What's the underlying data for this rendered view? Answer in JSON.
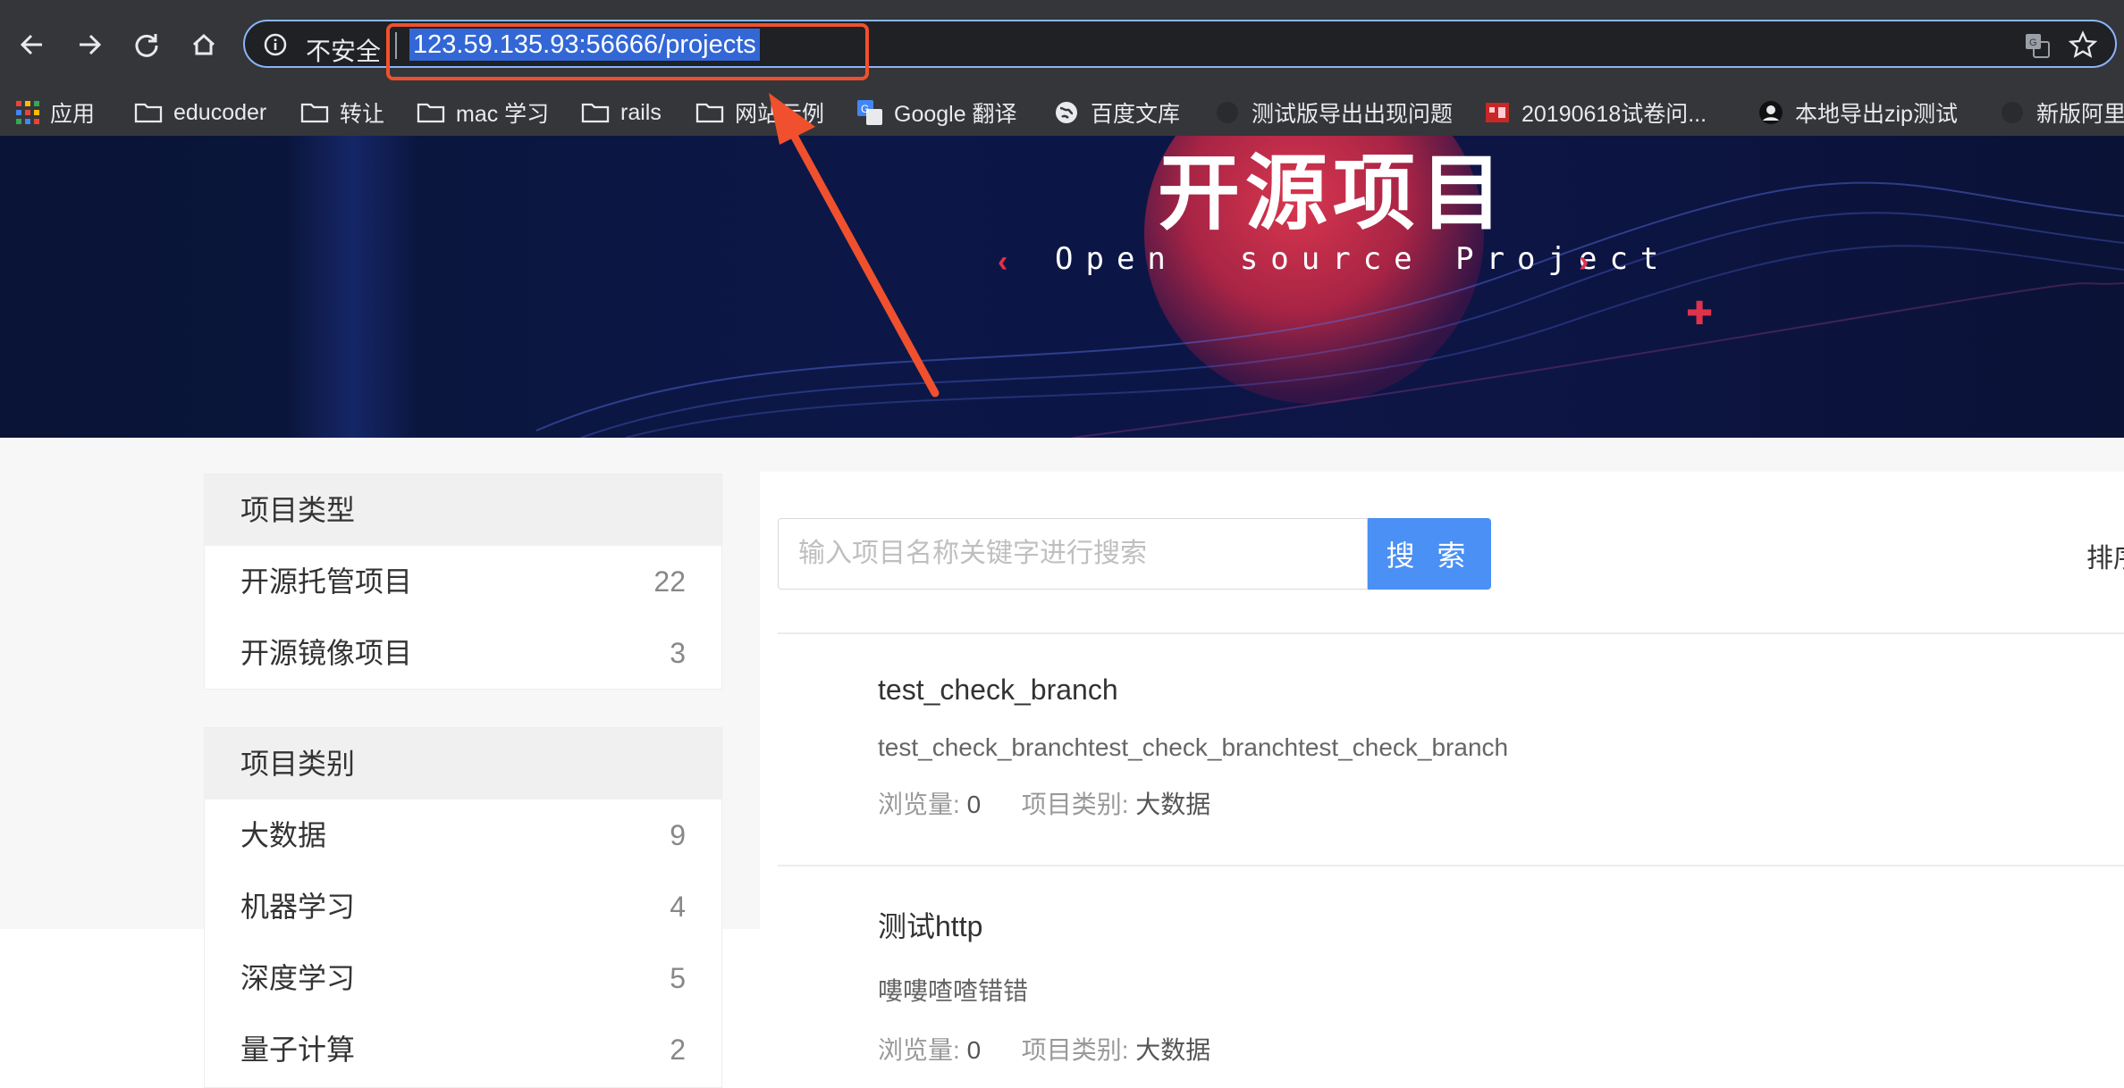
{
  "browser": {
    "security_label": "不安全",
    "url": "123.59.135.93:56666/projects",
    "bookmarks": [
      {
        "label": "应用",
        "icon": "apps-grid-icon"
      },
      {
        "label": "educoder",
        "icon": "folder-icon"
      },
      {
        "label": "转让",
        "icon": "folder-icon"
      },
      {
        "label": "mac 学习",
        "icon": "folder-icon"
      },
      {
        "label": "rails",
        "icon": "folder-icon"
      },
      {
        "label": "网站示例",
        "icon": "folder-icon"
      },
      {
        "label": "Google 翻译",
        "icon": "google-translate-icon"
      },
      {
        "label": "百度文库",
        "icon": "globe-icon"
      },
      {
        "label": "测试版导出出现问题",
        "icon": "github-icon"
      },
      {
        "label": "20190618试卷问...",
        "icon": "site-favicon"
      },
      {
        "label": "本地导出zip测试",
        "icon": "avatar-icon"
      },
      {
        "label": "新版阿里",
        "icon": "site-favicon"
      }
    ]
  },
  "banner": {
    "title": "开源项目",
    "subtitle": "Open  source Project"
  },
  "sidebar": {
    "type_panel": {
      "header": "项目类型",
      "items": [
        {
          "label": "开源托管项目",
          "count": "22"
        },
        {
          "label": "开源镜像项目",
          "count": "3"
        }
      ]
    },
    "category_panel": {
      "header": "项目类别",
      "items": [
        {
          "label": "大数据",
          "count": "9"
        },
        {
          "label": "机器学习",
          "count": "4"
        },
        {
          "label": "深度学习",
          "count": "5"
        },
        {
          "label": "量子计算",
          "count": "2"
        }
      ]
    }
  },
  "search": {
    "placeholder": "输入项目名称关键字进行搜索",
    "button_label": "搜 索",
    "sort_label": "排序"
  },
  "projects": [
    {
      "title": "test_check_branch",
      "description": "test_check_branchtest_check_branchtest_check_branch",
      "views_label": "浏览量:",
      "views": "0",
      "category_label": "项目类别:",
      "category": "大数据"
    },
    {
      "title": "测试http",
      "description": "嘍嘍喳喳错错",
      "views_label": "浏览量:",
      "views": "0",
      "category_label": "项目类别:",
      "category": "大数据"
    }
  ],
  "colors": {
    "chrome_bg": "#35363a",
    "banner_bg": "#0c1747",
    "accent_blue": "#4a90f5",
    "annotation": "#f0502d"
  }
}
